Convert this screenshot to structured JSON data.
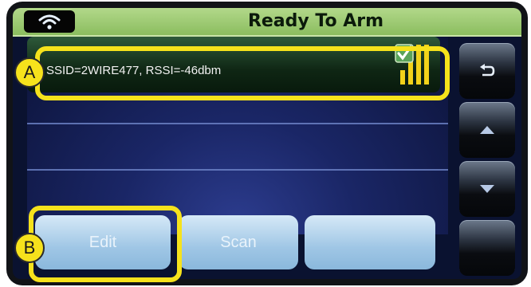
{
  "header": {
    "title": "Ready To Arm",
    "wifi_icon": "wifi-icon"
  },
  "network_list": {
    "selected_row": {
      "ssid_line": "SSID=2WIRE477, RSSI=-46dbm",
      "checked": true,
      "signal_bars_lit": 3,
      "signal_bars_total": 3
    }
  },
  "side_buttons": [
    {
      "name": "back-button",
      "icon": "back-arrow-icon"
    },
    {
      "name": "scroll-up-button",
      "icon": "triangle-up-icon"
    },
    {
      "name": "scroll-down-button",
      "icon": "triangle-down-icon"
    },
    {
      "name": "blank-side-button",
      "icon": ""
    }
  ],
  "bottom_buttons": {
    "edit_label": "Edit",
    "scan_label": "Scan",
    "third_label": ""
  },
  "callouts": {
    "a_label": "A",
    "b_label": "B"
  },
  "colors": {
    "callout": "#f6e21c",
    "header": "#9ccb72",
    "button_light_blue": "#a9cdea"
  }
}
